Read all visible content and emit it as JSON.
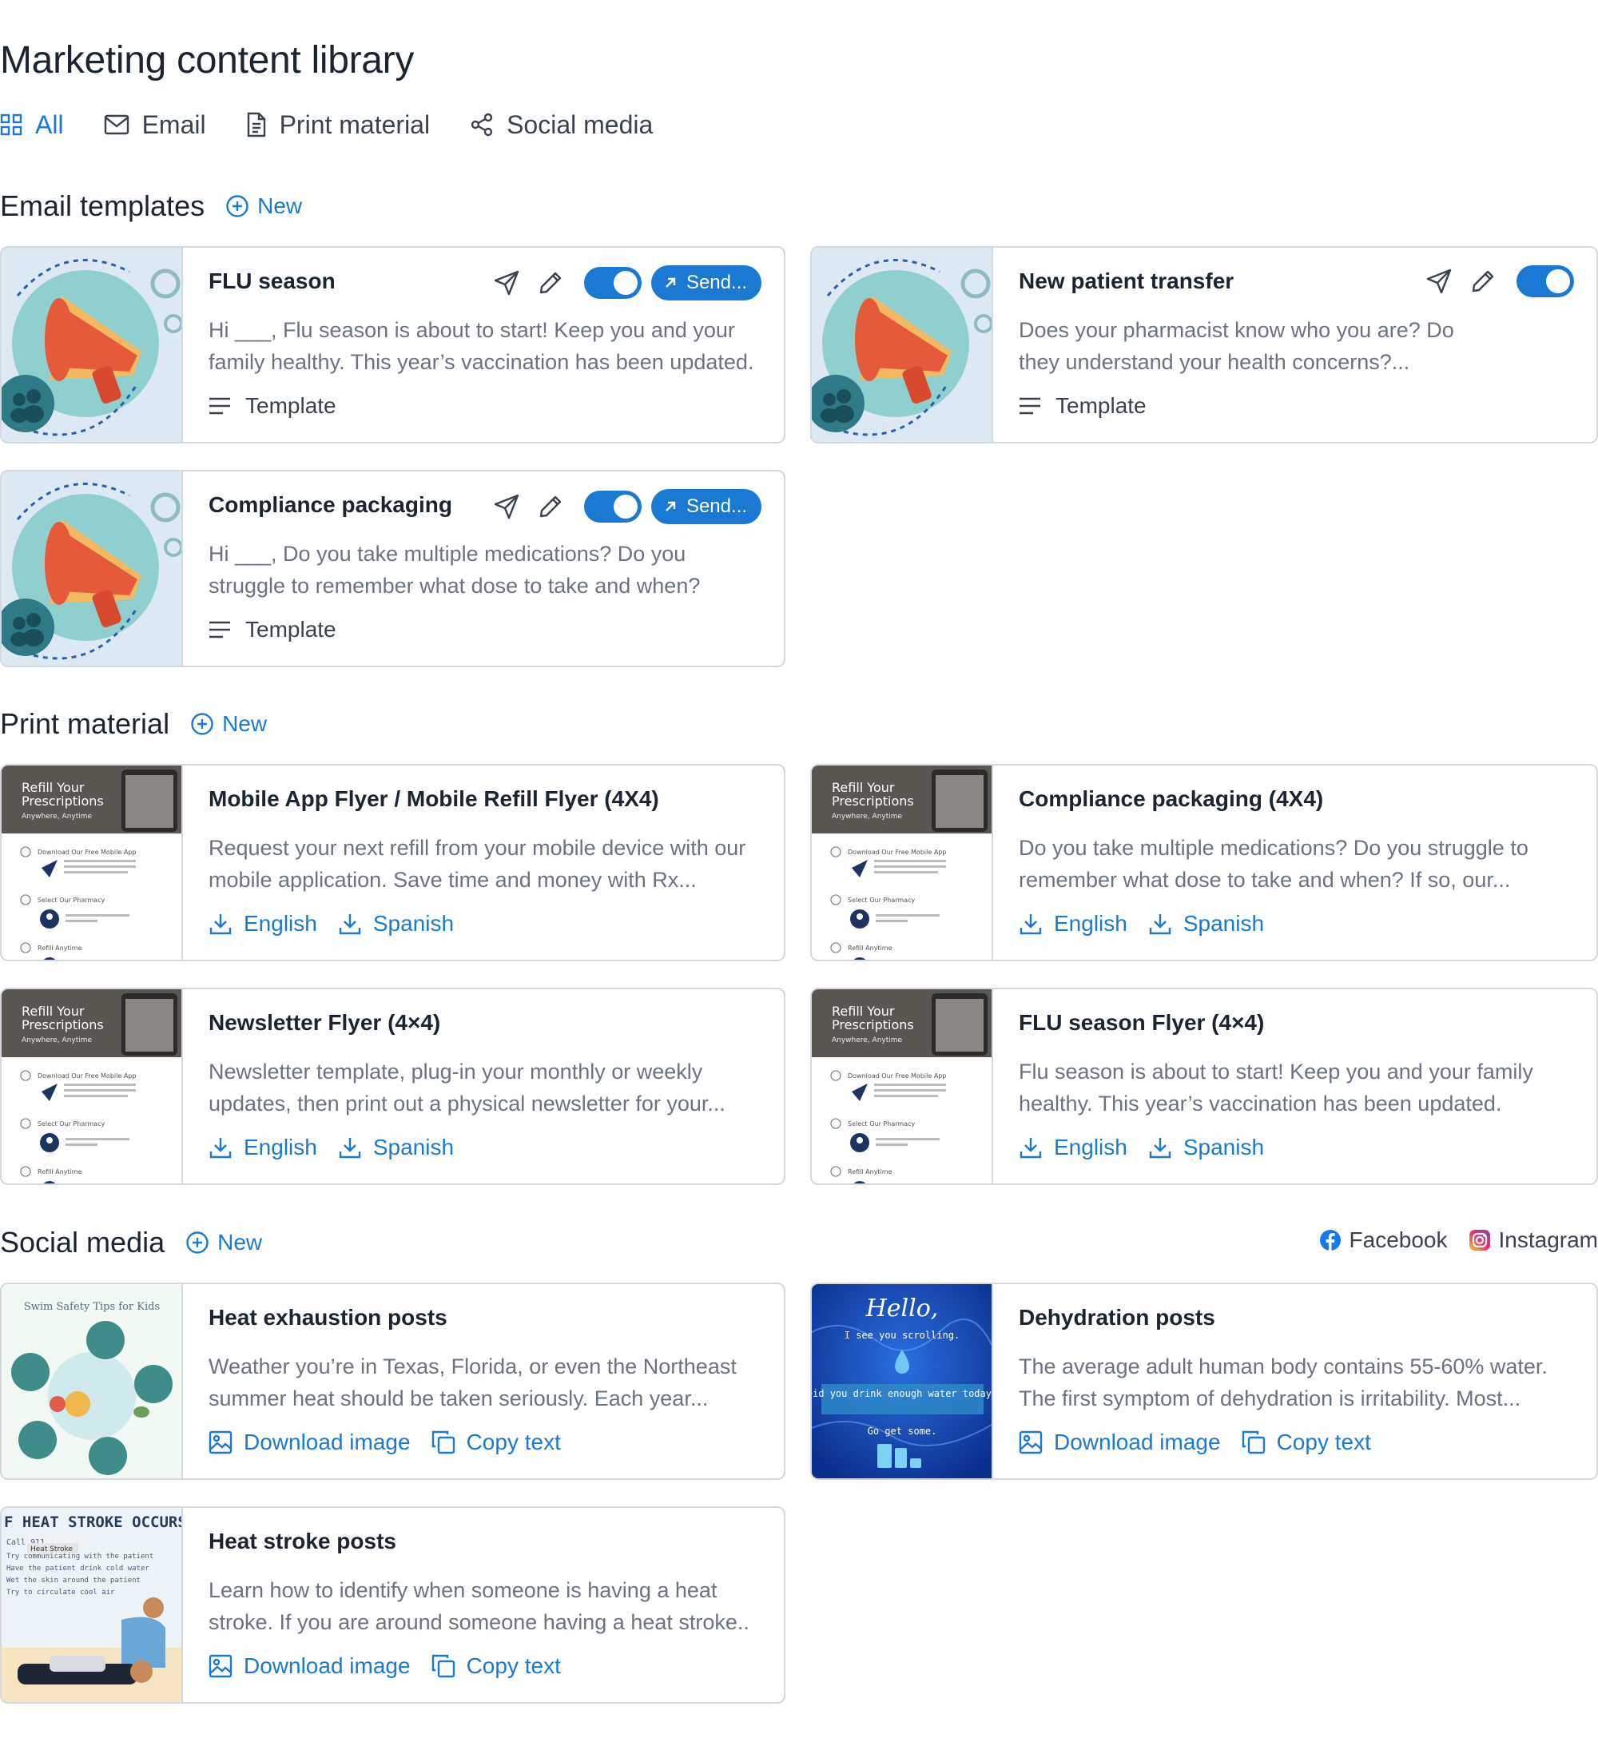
{
  "page": {
    "title": "Marketing content library"
  },
  "tabs": [
    {
      "label": "All",
      "icon": "grid-icon",
      "active": true
    },
    {
      "label": "Email",
      "icon": "mail-icon"
    },
    {
      "label": "Print material",
      "icon": "document-icon"
    },
    {
      "label": "Social media",
      "icon": "share-icon"
    }
  ],
  "colors": {
    "accent": "#1a7ad3",
    "border": "#d5d9df",
    "muted": "#6b7280"
  },
  "email": {
    "title": "Email templates",
    "new_label": "New",
    "cards": [
      {
        "title": "FLU season",
        "desc": "Hi ___, Flu season is about to start! Keep you and your family healthy. This year’s vaccination has been updated.",
        "footer": "Template",
        "send": "Send...",
        "toggle": true
      },
      {
        "title": "New patient transfer",
        "desc": "Does your pharmacist know who you are? Do they understand your health concerns?...",
        "footer": "Template",
        "toggle": true
      },
      {
        "title": "Compliance packaging",
        "desc": "Hi ___, Do you take multiple medications? Do you struggle to remember what dose to take and when?",
        "footer": "Template",
        "send": "Send...",
        "toggle": true
      }
    ]
  },
  "print": {
    "title": "Print material",
    "new_label": "New",
    "thumb": {
      "h1": "Refill Your",
      "h2": "Prescriptions",
      "h3": "Anywhere, Anytime",
      "s1": "Download Our Free Mobile App",
      "s2": "Select Our Pharmacy",
      "s3": "Refill Anytime"
    },
    "cards": [
      {
        "title": "Mobile App Flyer / Mobile Refill Flyer (4X4)",
        "desc": "Request your next refill from your mobile device with our mobile application. Save time and money with Rx...",
        "lang1": "English",
        "lang2": "Spanish"
      },
      {
        "title": "Compliance packaging (4X4)",
        "desc": "Do you take multiple medications? Do you struggle to remember what dose to take and when? If so, our...",
        "lang1": "English",
        "lang2": "Spanish"
      },
      {
        "title": "Newsletter Flyer (4×4)",
        "desc": "Newsletter template, plug-in your monthly or weekly updates, then print out a physical newsletter for your...",
        "lang1": "English",
        "lang2": "Spanish"
      },
      {
        "title": "FLU season Flyer (4×4)",
        "desc": "Flu season is about to start! Keep you and your family healthy. This year’s vaccination has been updated.",
        "lang1": "English",
        "lang2": "Spanish"
      }
    ]
  },
  "social": {
    "title": "Social media",
    "new_label": "New",
    "filters": [
      {
        "label": "Facebook",
        "icon": "facebook-icon"
      },
      {
        "label": "Instagram",
        "icon": "instagram-icon"
      }
    ],
    "cards": [
      {
        "title": "Heat exhaustion posts",
        "desc": "Weather you’re in Texas, Florida, or even the Northeast summer heat should be taken seriously. Each year...",
        "dl": "Download image",
        "copy": "Copy text",
        "thumb": {
          "t": "Swim Safety Tips for Kids"
        }
      },
      {
        "title": "Dehydration posts",
        "desc": "The average adult human body contains 55-60% water. The first symptom of dehydration is irritability. Most...",
        "dl": "Download image",
        "copy": "Copy text",
        "thumb": {
          "t1": "Hello,",
          "t2": "I see you scrolling.",
          "t3": "Did you drink enough water today?",
          "t4": "Go get some."
        }
      },
      {
        "title": "Heat stroke posts",
        "desc": "Learn how to identify when someone is having a heat stroke. If you are around someone having a heat stroke..",
        "dl": "Download image",
        "copy": "Copy text",
        "thumb": {
          "t1": "F HEAT STROKE OCCURS:",
          "t2": "Call 911",
          "t3": "Try communicating with the patient",
          "t4": "Have the patient drink cold water",
          "t5": "Wet the skin around the patient",
          "t6": "Try to circulate cool air",
          "tag": "Heat Stroke"
        }
      }
    ]
  }
}
